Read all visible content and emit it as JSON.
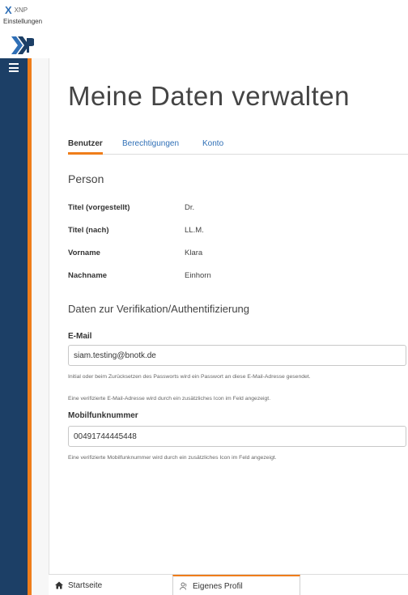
{
  "app": {
    "name": "XNP",
    "window_title": "Einstellungen"
  },
  "page": {
    "title": "Meine Daten verwalten"
  },
  "tabs": [
    {
      "label": "Benutzer",
      "active": true
    },
    {
      "label": "Berechtigungen",
      "active": false
    },
    {
      "label": "Konto",
      "active": false
    }
  ],
  "person": {
    "section_title": "Person",
    "fields": [
      {
        "label": "Titel (vorgestellt)",
        "value": "Dr."
      },
      {
        "label": "Titel (nach)",
        "value": "LL.M."
      },
      {
        "label": "Vorname",
        "value": "Klara"
      },
      {
        "label": "Nachname",
        "value": "Einhorn"
      }
    ]
  },
  "verification": {
    "section_title": "Daten zur Verifikation/Authentifizierung",
    "email": {
      "label": "E-Mail",
      "value": "siam.testing@bnotk.de",
      "hint1": "Initial oder beim Zurücksetzen des Passworts wird ein Passwort an diese E-Mail-Adresse gesendet.",
      "hint2": "Eine verifizierte E-Mail-Adresse wird durch ein zusätzliches Icon im Feld angezeigt."
    },
    "mobile": {
      "label": "Mobilfunknummer",
      "value": "00491744445448",
      "hint": "Eine verifizierte Mobilfunknummer wird durch ein zusätzliches Icon im Feld angezeigt."
    }
  },
  "bottom_tabs": [
    {
      "label": "Startseite",
      "icon": "home-icon",
      "active": false
    },
    {
      "label": "Eigenes Profil",
      "icon": "person-icon",
      "active": true
    }
  ],
  "colors": {
    "sidebar": "#1c3f66",
    "accent": "#ef7d1a",
    "link": "#2f6fb6"
  }
}
